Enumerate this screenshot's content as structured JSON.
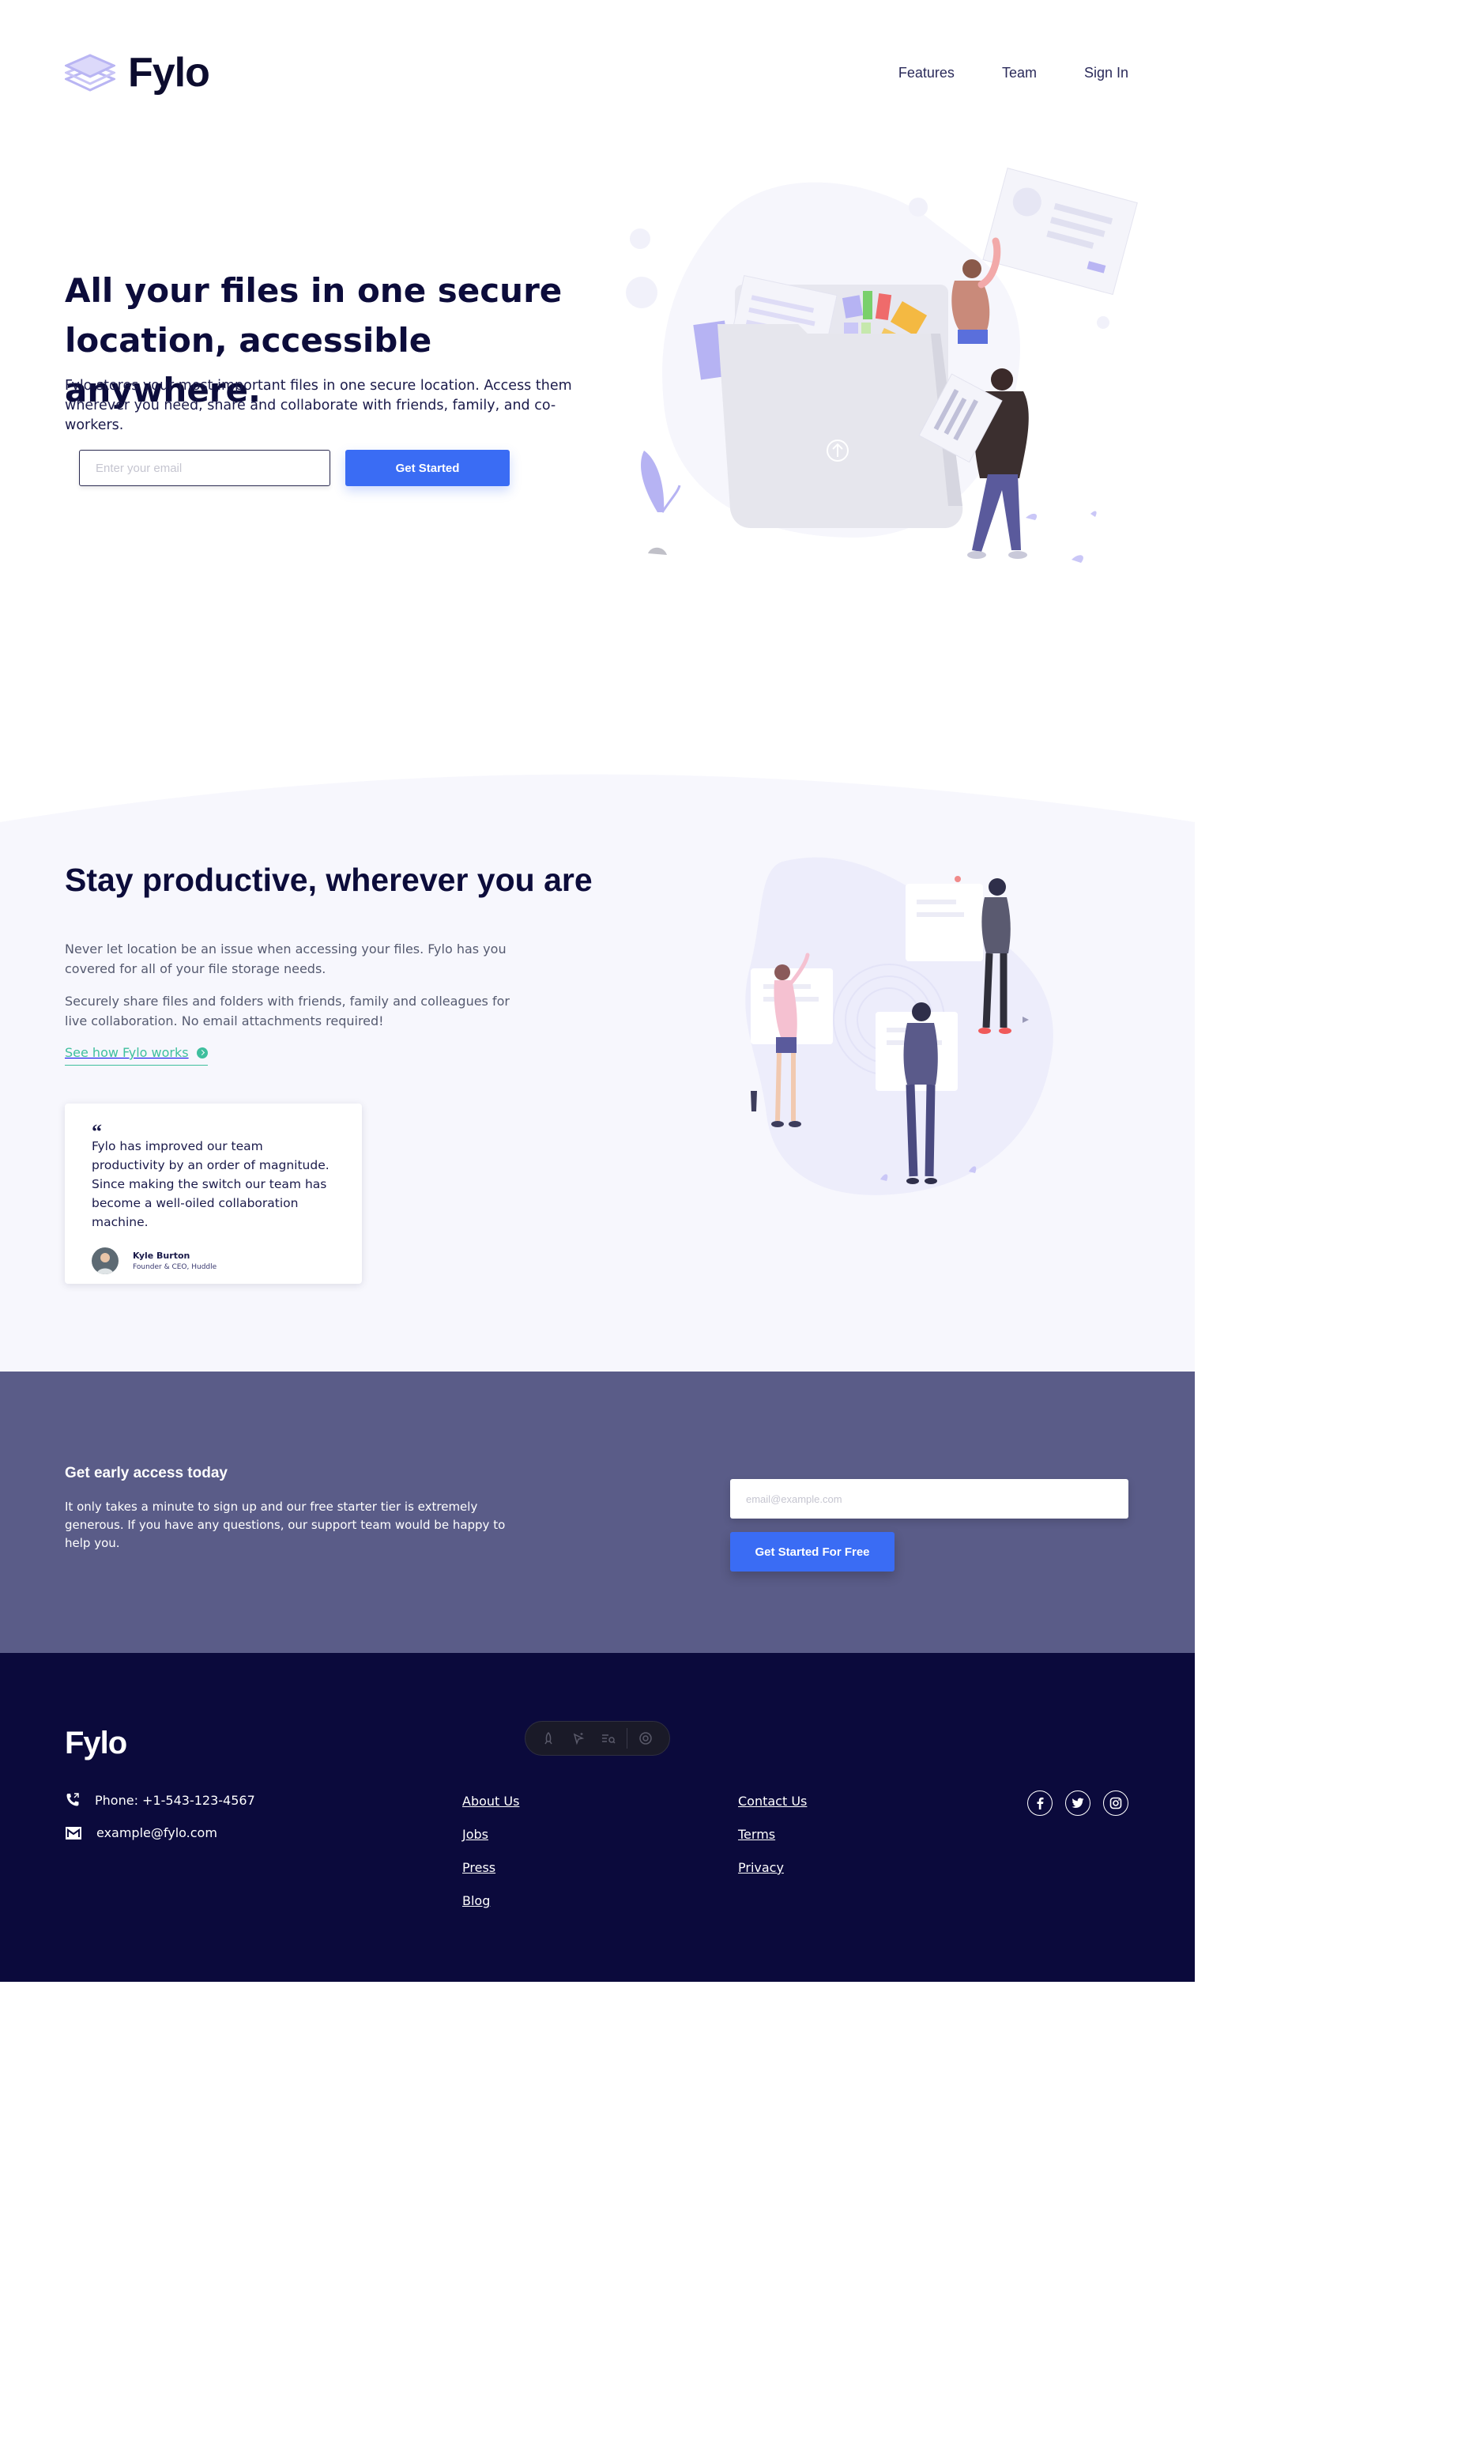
{
  "header": {
    "logo_text": "Fylo",
    "nav": [
      "Features",
      "Team",
      "Sign In"
    ]
  },
  "hero": {
    "title": "All your files in one secure location, accessible anywhere.",
    "subtitle": "Fylo stores your most important files in one secure location. Access them wherever you need, share and collaborate with friends, family, and co-workers.",
    "email_placeholder": "Enter your email",
    "cta_label": "Get Started"
  },
  "productive": {
    "title": "Stay productive, wherever you are",
    "paragraph_1": "Never let location be an issue when accessing your files. Fylo has you covered for all of your file storage needs.",
    "paragraph_2": "Securely share files and folders with friends, family and colleagues for live collaboration. No email attachments required!",
    "link_label": "See how Fylo works",
    "testimonial": {
      "quote_mark": "“",
      "text": "Fylo has improved our team productivity by an order of magnitude. Since making the switch our team has become a well-oiled collaboration machine.",
      "author_name": "Kyle Burton",
      "author_role": "Founder & CEO, Huddle"
    }
  },
  "early_access": {
    "title": "Get early access today",
    "text": "It only takes a minute to sign up and our free starter tier is extremely generous. If you have any questions, our support team would be happy to help you.",
    "email_placeholder": "email@example.com",
    "cta_label": "Get Started For Free"
  },
  "footer": {
    "logo_text": "Fylo",
    "phone": "Phone: +1-543-123-4567",
    "email": "example@fylo.com",
    "links_col1": [
      "About Us",
      "Jobs",
      "Press",
      "Blog"
    ],
    "links_col2": [
      "Contact Us",
      "Terms",
      "Privacy"
    ],
    "socials": [
      "facebook-icon",
      "twitter-icon",
      "instagram-icon"
    ]
  },
  "colors": {
    "primary_blue": "#3a6cf4",
    "navy": "#0b0a3c",
    "early_access_bg": "#5a5c88",
    "accent_teal": "#3fbf9e",
    "light_section_bg": "#f7f7fd"
  }
}
